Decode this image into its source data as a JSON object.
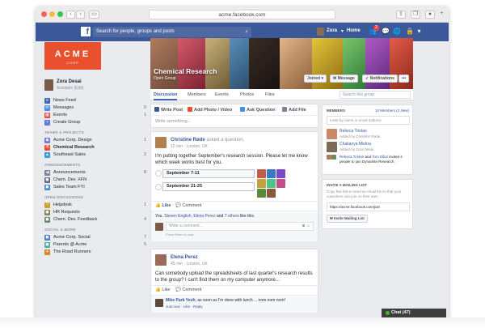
{
  "browser": {
    "url": "acme.facebook.com"
  },
  "topbar": {
    "search_placeholder": "Search for people, groups and posts",
    "user_name": "Zora",
    "home_label": "Home",
    "notif_count": "2"
  },
  "sidebar": {
    "logo_text": "ACME",
    "logo_sub": "CORP",
    "profile_name": "Zora Desai",
    "profile_status": "Available (Edit)",
    "main_items": [
      {
        "label": "News Feed",
        "count": ""
      },
      {
        "label": "Messages",
        "count": "5"
      },
      {
        "label": "Events",
        "count": "1"
      },
      {
        "label": "Create Group",
        "count": ""
      }
    ],
    "teams_title": "TEAMS & PROJECTS",
    "teams_items": [
      {
        "label": "Acme Corp. Design",
        "count": "1"
      },
      {
        "label": "Chemical Research",
        "count": ""
      },
      {
        "label": "Southeast Sales",
        "count": "2"
      }
    ],
    "announce_title": "ANNOUNCEMENTS",
    "announce_items": [
      {
        "label": "Announcements",
        "count": "8"
      },
      {
        "label": "Chem. Dev. XFN",
        "count": ""
      },
      {
        "label": "Sales Team FYI",
        "count": ""
      }
    ],
    "open_title": "OPEN DISCUSSIONS",
    "open_items": [
      {
        "label": "Helpdesk",
        "count": "1"
      },
      {
        "label": "HR Requests",
        "count": ""
      },
      {
        "label": "Chem. Dev. Feedback",
        "count": "4"
      }
    ],
    "social_title": "SOCIAL & MORE",
    "social_items": [
      {
        "label": "Acme Corp. Social",
        "count": "7"
      },
      {
        "label": "Parents @ Acme",
        "count": "5"
      },
      {
        "label": "The Road Runners",
        "count": ""
      }
    ]
  },
  "group": {
    "title": "Chemical Research",
    "subtitle": "Open Group",
    "joined_label": "Joined ▾",
    "message_label": "Message",
    "notifications_label": "Notifications",
    "more_label": "•••",
    "tabs": [
      "Discussion",
      "Members",
      "Events",
      "Photos",
      "Files"
    ],
    "search_placeholder": "Search this group"
  },
  "composer": {
    "tabs": [
      "Write Post",
      "Add Photo / Video",
      "Ask Question",
      "Add File"
    ],
    "placeholder": "Write something..."
  },
  "post1": {
    "author": "Christine Røde",
    "action": "asked a question.",
    "meta": "12 min · London, UK",
    "text": "I'm putting together September's research session. Please let me know which week works best for you.",
    "options": [
      "September 7-11",
      "September 21-25"
    ],
    "like": "Like",
    "comment": "Comment",
    "likes_prefix": "You,",
    "likes_names": "Steven English, Elena Perez",
    "likes_and": "and",
    "likes_others": "7 others",
    "likes_suffix": "like this.",
    "comment_placeholder": "Write a comment...",
    "comment_hint": "Press Enter to post."
  },
  "post2": {
    "author": "Elena Perez",
    "meta": "45 min · London, UK",
    "text": "Can somebody upload the spreadsheets of last quarter's research results to the group? I can't find them on my computer anymore...",
    "like": "Like",
    "comment": "Comment",
    "reply_author": "Mike Park Yeoh",
    "reply_text": ", as soon as I'm done with lunch ... nom nom nom!",
    "reply_meta": "Just now · Like · Reply"
  },
  "members": {
    "title": "MEMBERS",
    "count": "10 Members (2 New)",
    "invite_placeholder": "Invite by name or email address",
    "m1_name": "Rebeca Tristan",
    "m1_sub": "Added by Christine Røde.",
    "m2_name": "Chaitanya Mishra",
    "m2_sub": "Added by Zora Desai.",
    "invited_names": "Rebeca Tristan",
    "invited_mid": "and",
    "invited_name2": "Tom Elliot",
    "invited_text": "invited 4 people to join Dynamite Research."
  },
  "mailing": {
    "title": "INVITE A MAILING LIST",
    "desc": "Copy this link to send an email list so that your coworkers can join on their own.",
    "url": "https://acme.facebook.com/join",
    "button": "Invite Mailing List"
  },
  "chat": {
    "label": "Chat (47)"
  },
  "colors": {
    "fb_blue": "#3b5998",
    "acme_orange": "#e8502e",
    "link": "#365899"
  }
}
